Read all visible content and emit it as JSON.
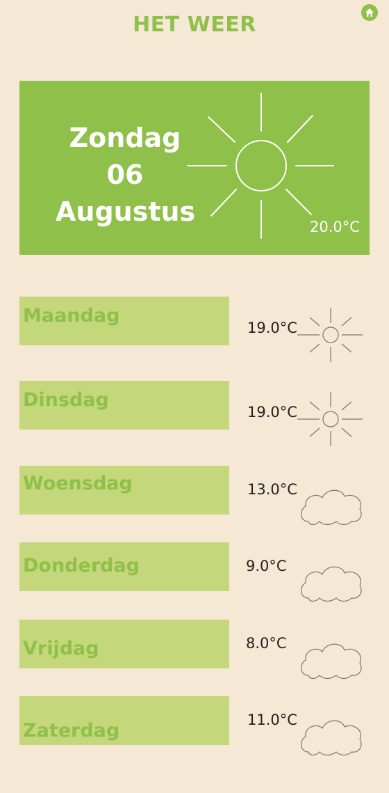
{
  "header": {
    "title": "HET WEER",
    "home_icon": "home-icon"
  },
  "today": {
    "weekday": "Zondag",
    "day": "06",
    "month": "Augustus",
    "temperature": "20.0°C",
    "icon": "sun-icon"
  },
  "forecast": [
    {
      "day": "Maandag",
      "temperature": "19.0°C",
      "icon": "sun-icon"
    },
    {
      "day": "Dinsdag",
      "temperature": "19.0°C",
      "icon": "sun-icon"
    },
    {
      "day": "Woensdag",
      "temperature": "13.0°C",
      "icon": "cloud-icon"
    },
    {
      "day": "Donderdag",
      "temperature": "9.0°C",
      "icon": "cloud-icon"
    },
    {
      "day": "Vrijdag",
      "temperature": "8.0°C",
      "icon": "cloud-icon"
    },
    {
      "day": "Zaterdag",
      "temperature": "11.0°C",
      "icon": "cloud-icon"
    }
  ],
  "colors": {
    "accent": "#8fc04a",
    "light_accent": "#c4d77a",
    "background": "#f5e8d5"
  }
}
